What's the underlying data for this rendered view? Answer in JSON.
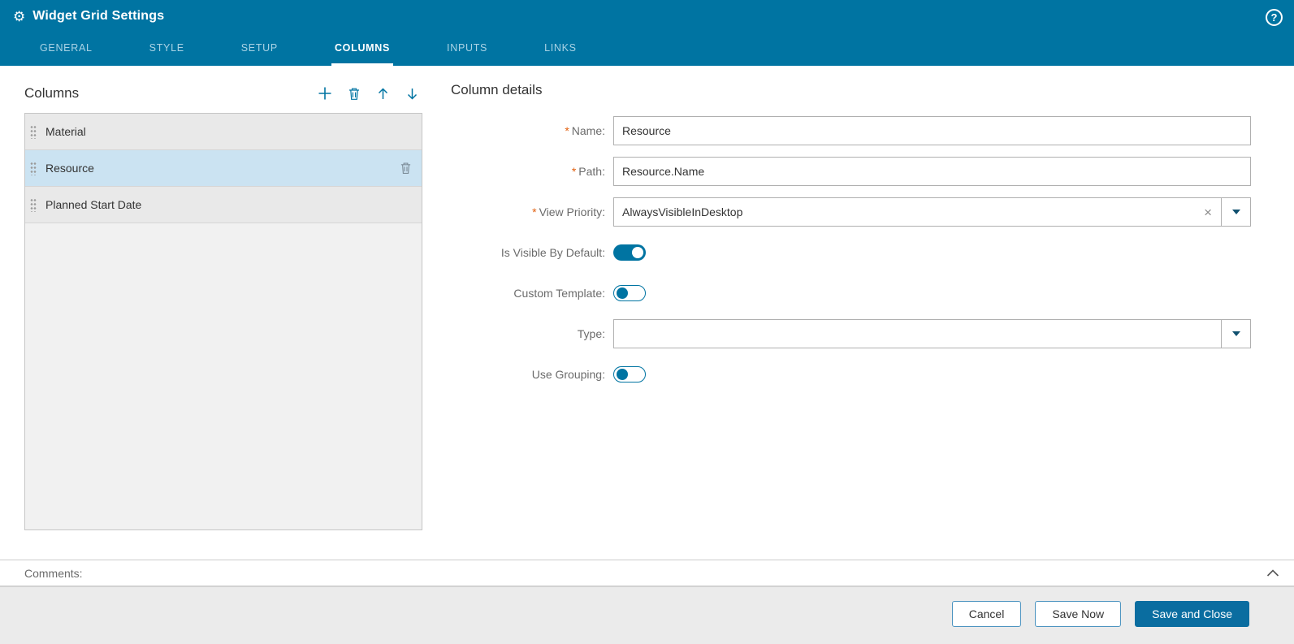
{
  "header": {
    "title": "Widget Grid Settings",
    "help": "?"
  },
  "tabs": [
    {
      "label": "GENERAL",
      "active": false
    },
    {
      "label": "STYLE",
      "active": false
    },
    {
      "label": "SETUP",
      "active": false
    },
    {
      "label": "COLUMNS",
      "active": true
    },
    {
      "label": "INPUTS",
      "active": false
    },
    {
      "label": "LINKS",
      "active": false
    }
  ],
  "columns_panel": {
    "title": "Columns",
    "items": [
      {
        "label": "Material",
        "selected": false
      },
      {
        "label": "Resource",
        "selected": true
      },
      {
        "label": "Planned Start Date",
        "selected": false
      }
    ]
  },
  "details_panel": {
    "title": "Column details",
    "required_marker": "*",
    "fields": {
      "name": {
        "label": "Name:",
        "required": true,
        "value": "Resource"
      },
      "path": {
        "label": "Path:",
        "required": true,
        "value": "Resource.Name"
      },
      "view_priority": {
        "label": "View Priority:",
        "required": true,
        "value": "AlwaysVisibleInDesktop"
      },
      "is_visible": {
        "label": "Is Visible By Default:",
        "on": true
      },
      "custom_template": {
        "label": "Custom Template:",
        "on": false
      },
      "type": {
        "label": "Type:",
        "value": ""
      },
      "use_grouping": {
        "label": "Use Grouping:",
        "on": false
      }
    },
    "clear_glyph": "×"
  },
  "comments": {
    "label": "Comments:"
  },
  "footer": {
    "buttons": [
      {
        "label": "Cancel",
        "primary": false
      },
      {
        "label": "Save Now",
        "primary": false
      },
      {
        "label": "Save and Close",
        "primary": true
      }
    ]
  },
  "colors": {
    "header_bg": "#0074a2",
    "accent": "#0074a2",
    "selected_row_bg": "#cbe3f2",
    "required_asterisk": "#e2600f",
    "primary_button_bg": "#0a6da0",
    "footer_bg": "#ebebeb"
  }
}
